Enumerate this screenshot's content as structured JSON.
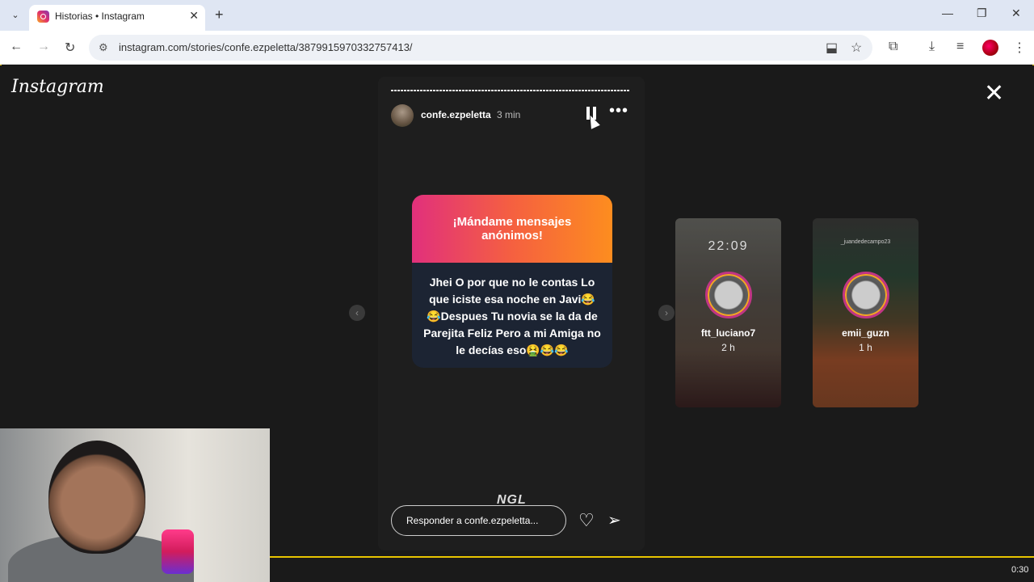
{
  "browser": {
    "tab_title": "Historias • Instagram",
    "url": "instagram.com/stories/confe.ezpeletta/3879915970332757413/"
  },
  "page": {
    "logo_text": "Instagram"
  },
  "story": {
    "username": "confe.ezpeletta",
    "time": "3 min",
    "progress_fraction": 1.0,
    "card_title": "¡Mándame mensajes anónimos!",
    "card_message": "Jhei O por que no le contas Lo que iciste esa noche en Javi😂 😂Despues Tu novia se la da de Parejita Feliz Pero a mi Amiga no le decías eso🤮😂😂",
    "sticker": "NGL",
    "reply_placeholder": "Responder a confe.ezpeletta..."
  },
  "previews": [
    {
      "username": "ftt_luciano7",
      "time": "2 h",
      "overlay_text": "22:09"
    },
    {
      "username": "emii_guzn",
      "time": "1 h",
      "overlay_text": "_juandedecampo23"
    }
  ],
  "video_timer": "0:30",
  "colors": {
    "accent_pink": "#e1307c",
    "accent_orange": "#fd8d1f",
    "card_body": "#1c2433",
    "frame_border": "#e8c400"
  }
}
